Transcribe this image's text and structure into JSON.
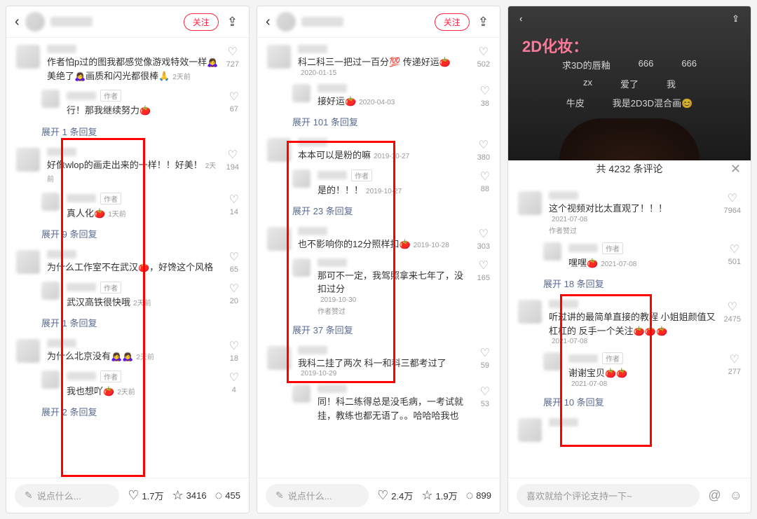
{
  "common": {
    "follow": "关注",
    "author_tag": "作者",
    "author_liked": "作者赞过"
  },
  "screen1": {
    "input_placeholder": "说点什么...",
    "stats": {
      "likes": "1.7万",
      "stars": "3416",
      "comments": "455"
    },
    "comments": [
      {
        "text": "作者怕p过的图我都感觉像游戏特效一样🙇‍♀️美绝了🙇‍♀️画质和闪光都很棒🙏",
        "time": "2天前",
        "likes": "727"
      },
      {
        "text": "行！那我继续努力🍅",
        "time": "",
        "likes": "67",
        "author": true,
        "reply": true
      },
      {
        "expand": "展开 1 条回复"
      },
      {
        "text": "好像wlop的画走出来的一样！！好美！",
        "time": "2天前",
        "likes": "194"
      },
      {
        "text": "真人化🍅",
        "time": "1天前",
        "likes": "14",
        "author": true,
        "reply": true
      },
      {
        "expand": "展开 9 条回复"
      },
      {
        "text": "为什么工作室不在武汉🍅，好馋这个风格",
        "time": "",
        "likes": "65"
      },
      {
        "text": "武汉高铁很快哦",
        "time": "2天前",
        "likes": "20",
        "author": true,
        "reply": true
      },
      {
        "expand": "展开 1 条回复"
      },
      {
        "text": "为什么北京没有🙇‍♀️🙇‍♀️",
        "time": "2天前",
        "likes": "18"
      },
      {
        "text": "我也想吖🍅",
        "time": "2天前",
        "likes": "4",
        "author": true,
        "reply": true
      },
      {
        "expand": "展开 2 条回复"
      }
    ]
  },
  "screen2": {
    "input_placeholder": "说点什么...",
    "stats": {
      "likes": "2.4万",
      "stars": "1.9万",
      "comments": "899"
    },
    "comments": [
      {
        "text": "科二科三一把过一百分💯 传递好运🍅",
        "time": "2020-01-15",
        "likes": "502"
      },
      {
        "text": "接好运🍅",
        "time": "2020-04-03",
        "likes": "38",
        "reply": true
      },
      {
        "expand": "展开 101 条回复"
      },
      {
        "text": "本本可以是粉的嘛",
        "time": "2019-10-27",
        "likes": "380"
      },
      {
        "text": "是的！！！",
        "time": "2019-10-27",
        "likes": "88",
        "author": true,
        "reply": true
      },
      {
        "expand": "展开 23 条回复"
      },
      {
        "text": "也不影响你的12分照样扣🍅",
        "time": "2019-10-28",
        "likes": "303"
      },
      {
        "text": "那可不一定，我驾照拿来七年了，没扣过分",
        "time": "2019-10-30",
        "likes": "165",
        "reply": true,
        "author_liked": true
      },
      {
        "expand": "展开 37 条回复"
      },
      {
        "text": "我科二挂了两次 科一和科三都考过了",
        "time": "2019-10-29",
        "likes": "59"
      },
      {
        "text": "同！科二练得总是没毛病，一考试就挂，教练也都无语了。。哈哈哈我也",
        "time": "",
        "likes": "53",
        "reply": true
      }
    ]
  },
  "screen3": {
    "video": {
      "title": "2D化妆：",
      "d1a": "求3D的唇釉",
      "d1b": "666",
      "d1c": "666",
      "d2a": "zx",
      "d2b": "爱了",
      "d2c": "我",
      "d3a": "牛皮",
      "d3b": "我是2D3D混合画😊"
    },
    "sheet_title": "共 4232 条评论",
    "input_placeholder": "喜欢就给个评论支持一下~",
    "comments": [
      {
        "text": "这个视频对比太直观了！！！",
        "time": "2021-07-08",
        "likes": "7964",
        "author_liked": true
      },
      {
        "text": "嘿嘿🍅",
        "time": "2021-07-08",
        "likes": "501",
        "author": true,
        "reply": true
      },
      {
        "expand": "展开 18 条回复"
      },
      {
        "text": "听过讲的最简单直接的教程 小姐姐颜值又杠杠的   反手一个关注🍅🍅🍅",
        "time": "2021-07-08",
        "likes": "2475"
      },
      {
        "text": "谢谢宝贝🍅🍅",
        "time": "2021-07-08",
        "likes": "277",
        "author": true,
        "reply": true
      },
      {
        "expand": "展开 10 条回复"
      }
    ]
  }
}
